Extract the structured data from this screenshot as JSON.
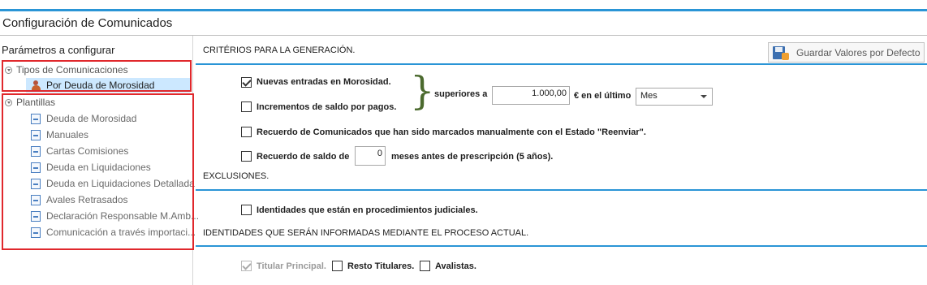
{
  "window": {
    "title": "Configuración de Comunicados"
  },
  "left_panel": {
    "header": "Parámetros a configurar",
    "groups": [
      {
        "label": "Tipos de Comunicaciones",
        "items": [
          {
            "label": "Por Deuda de Morosidad",
            "icon": "person-money-icon",
            "selected": true
          }
        ]
      },
      {
        "label": "Plantillas",
        "items": [
          {
            "label": "Deuda de Morosidad",
            "icon": "document-icon"
          },
          {
            "label": "Manuales",
            "icon": "document-icon"
          },
          {
            "label": "Cartas Comisiones",
            "icon": "document-icon"
          },
          {
            "label": "Deuda en Liquidaciones",
            "icon": "document-icon"
          },
          {
            "label": "Deuda en Liquidaciones Detallada",
            "icon": "document-icon"
          },
          {
            "label": "Avales Retrasados",
            "icon": "document-icon"
          },
          {
            "label": "Declaración Responsable M.Amb...",
            "icon": "document-icon"
          },
          {
            "label": "Comunicación a través importaci...",
            "icon": "document-icon"
          }
        ]
      }
    ]
  },
  "toolbar": {
    "save_defaults_label": "Guardar Valores por Defecto"
  },
  "criterios": {
    "title": "CRITÉRIOS PARA LA GENERACIÓN.",
    "nuevas_entradas": {
      "label": "Nuevas entradas en Morosidad.",
      "checked": true
    },
    "incrementos": {
      "label": "Incrementos de saldo por pagos.",
      "checked": false
    },
    "superiores_label": "superiores a",
    "amount_value": "1.000,00",
    "period_label": "€ en el último",
    "period_value": "Mes",
    "recuerdo_comunicados": {
      "label": "Recuerdo de Comunicados que han sido marcados manualmente con el Estado \"Reenviar\".",
      "checked": false
    },
    "recuerdo_saldo": {
      "label": "Recuerdo de saldo de",
      "checked": false,
      "months_value": "0",
      "suffix": "meses antes de prescripción (5 años)."
    }
  },
  "exclusiones": {
    "title": "EXCLUSIONES.",
    "identidades_judiciales": {
      "label": "Identidades que están en procedimientos judiciales.",
      "checked": false
    }
  },
  "identidades": {
    "title": "IDENTIDADES QUE SERÁN INFORMADAS MEDIANTE EL PROCESO ACTUAL.",
    "titular_principal": {
      "label": "Titular Principal.",
      "checked": true,
      "disabled": true
    },
    "resto_titulares": {
      "label": "Resto Titulares.",
      "checked": false
    },
    "avalistas": {
      "label": "Avalistas.",
      "checked": false
    }
  },
  "colors": {
    "accent": "#2a95d6",
    "highlight_box": "#e0282c",
    "selection": "#cce8ff"
  }
}
